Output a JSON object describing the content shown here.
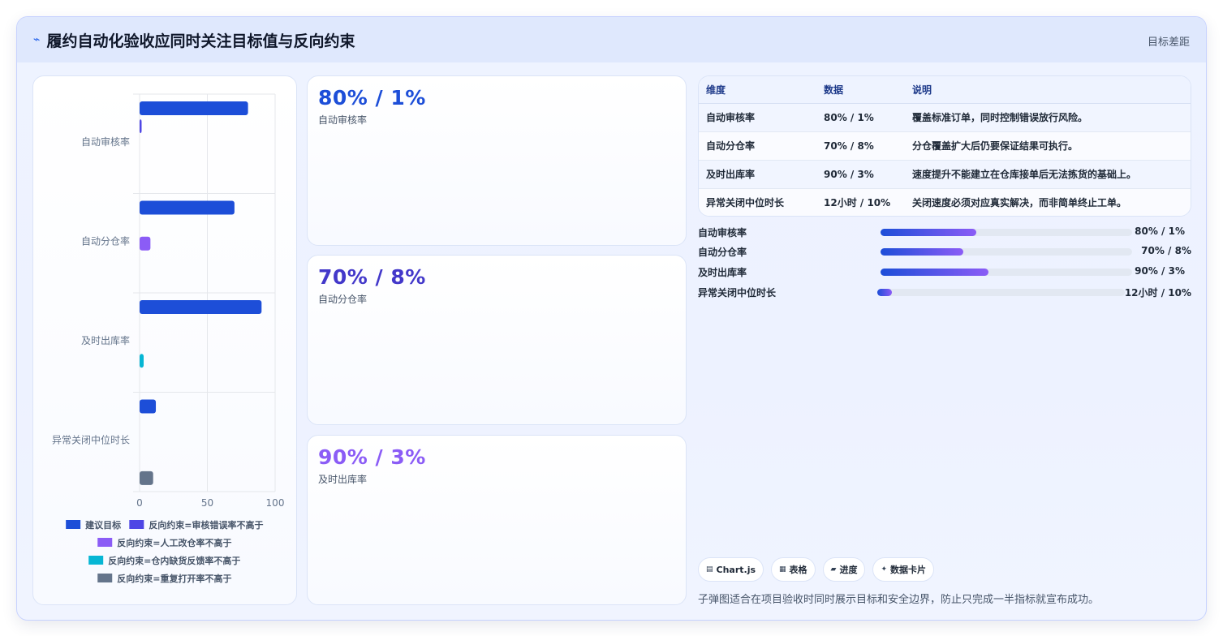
{
  "header": {
    "title": "履约自动化验收应同时关注目标值与反向约束",
    "right_label": "目标差距"
  },
  "stats": [
    {
      "value": "80% / 1%",
      "label": "自动审核率",
      "color": "#1d4ed8"
    },
    {
      "value": "70% / 8%",
      "label": "自动分仓率",
      "color": "#4338ca"
    },
    {
      "value": "90% / 3%",
      "label": "及时出库率",
      "color": "#8b5cf6"
    }
  ],
  "table": {
    "headers": [
      "维度",
      "数据",
      "说明"
    ],
    "rows": [
      [
        "自动审核率",
        "80% / 1%",
        "覆盖标准订单，同时控制错误放行风险。"
      ],
      [
        "自动分仓率",
        "70% / 8%",
        "分仓覆盖扩大后仍要保证结果可执行。"
      ],
      [
        "及时出库率",
        "90% / 3%",
        "速度提升不能建立在仓库接单后无法拣货的基础上。"
      ],
      [
        "异常关闭中位时长",
        "12小时 / 10%",
        "关闭速度必须对应真实解决，而非简单终止工单。"
      ]
    ]
  },
  "progress": [
    {
      "label": "自动审核率",
      "value": "80% / 1%",
      "fraction": 0.38
    },
    {
      "label": "自动分仓率",
      "value": "70% / 8%",
      "fraction": 0.33
    },
    {
      "label": "及时出库率",
      "value": "90% / 3%",
      "fraction": 0.43
    },
    {
      "label": "异常关闭中位时长",
      "value": "12小时 / 10%",
      "fraction": 0.06
    }
  ],
  "chips": [
    {
      "icon": "chart-icon",
      "glyph": "▤",
      "label": "Chart.js"
    },
    {
      "icon": "table-icon",
      "glyph": "▦",
      "label": "表格"
    },
    {
      "icon": "progress-icon",
      "glyph": "▰",
      "label": "进度"
    },
    {
      "icon": "card-icon",
      "glyph": "✦",
      "label": "数据卡片"
    }
  ],
  "footnote": "子弹图适合在项目验收时同时展示目标和安全边界，防止只完成一半指标就宣布成功。",
  "chart_data": {
    "type": "bar",
    "orientation": "horizontal",
    "categories": [
      "自动审核率",
      "自动分仓率",
      "及时出库率",
      "异常关闭中位时长"
    ],
    "series": [
      {
        "name": "建议目标",
        "values": [
          80,
          70,
          90,
          12
        ],
        "color": "#1d4ed8"
      },
      {
        "name": "反向约束=审核错误率不高于",
        "values": [
          1,
          null,
          null,
          null
        ],
        "color": "#4f46e5"
      },
      {
        "name": "反向约束=人工改仓率不高于",
        "values": [
          null,
          8,
          null,
          null
        ],
        "color": "#8b5cf6"
      },
      {
        "name": "反向约束=仓内缺货反馈率不高于",
        "values": [
          null,
          null,
          3,
          null
        ],
        "color": "#06b6d4"
      },
      {
        "name": "反向约束=重复打开率不高于",
        "values": [
          null,
          null,
          null,
          10
        ],
        "color": "#64748b"
      }
    ],
    "xlim": [
      0,
      100
    ],
    "xticks": [
      0,
      50,
      100
    ],
    "grid": true,
    "legend": "bottom"
  }
}
